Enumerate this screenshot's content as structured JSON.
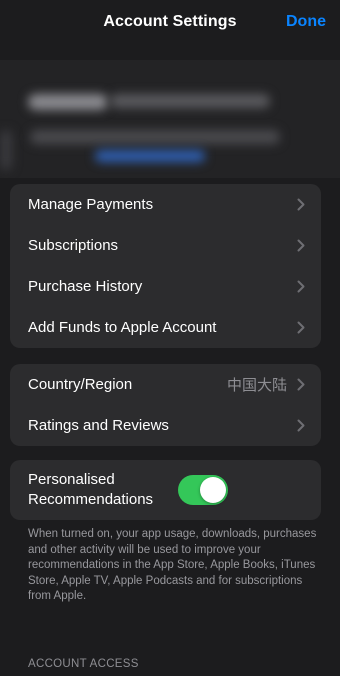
{
  "nav": {
    "title": "Account Settings",
    "done_label": "Done"
  },
  "payments_group": {
    "items": [
      {
        "label": "Manage Payments"
      },
      {
        "label": "Subscriptions"
      },
      {
        "label": "Purchase History"
      },
      {
        "label": "Add Funds to Apple Account"
      }
    ]
  },
  "region_group": {
    "items": [
      {
        "label": "Country/Region",
        "value": "中国大陆"
      },
      {
        "label": "Ratings and Reviews"
      }
    ]
  },
  "recommendations": {
    "label": "Personalised Recommendations",
    "enabled": true,
    "footnote": "When turned on, your app usage, downloads, purchases and other activity will be used to improve your recommendations in the App Store, Apple Books, iTunes Store, Apple TV, Apple Podcasts and for subscriptions from Apple."
  },
  "account_access": {
    "header": "ACCOUNT ACCESS"
  },
  "colors": {
    "accent": "#0a84ff",
    "toggle_on": "#34c759",
    "background": "#1c1c1e",
    "cell": "#2c2c2e"
  }
}
